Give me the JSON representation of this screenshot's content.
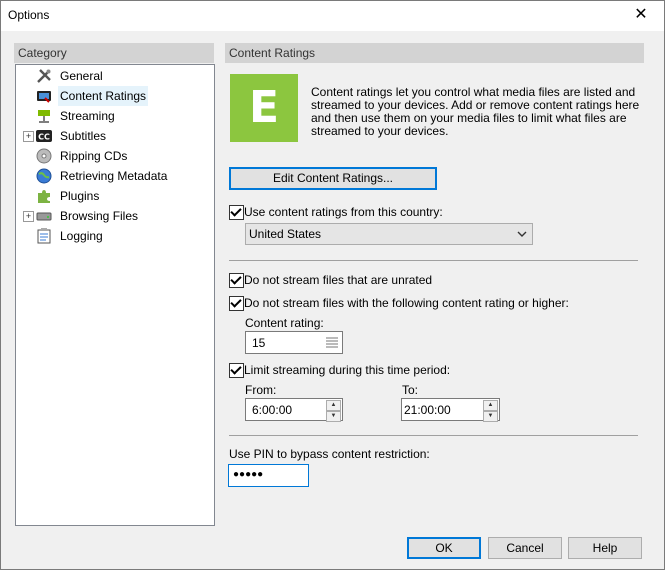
{
  "window": {
    "title": "Options"
  },
  "category": {
    "header": "Category",
    "items": [
      {
        "label": "General"
      },
      {
        "label": "Content Ratings"
      },
      {
        "label": "Streaming"
      },
      {
        "label": "Subtitles"
      },
      {
        "label": "Ripping CDs"
      },
      {
        "label": "Retrieving Metadata"
      },
      {
        "label": "Plugins"
      },
      {
        "label": "Browsing Files"
      },
      {
        "label": "Logging"
      }
    ]
  },
  "panel": {
    "header": "Content Ratings",
    "badge_letter": "E",
    "badge_color": "#8cc63f",
    "description": "Content ratings let you control what media files are listed and streamed to your devices.  Add or remove content ratings here and then use them on your media files to limit what files are streamed to your devices.",
    "edit_button": "Edit Content Ratings...",
    "use_country_label": "Use content ratings from this country:",
    "country": "United States",
    "unrated_label": "Do not stream files that are unrated",
    "rating_or_higher_label": "Do not stream files with the following content rating or higher:",
    "content_rating_label": "Content rating:",
    "content_rating_value": "15",
    "limit_time_label": "Limit streaming during this time period:",
    "from_label": "From:",
    "from_value": "6:00:00",
    "to_label": "To:",
    "to_value": "21:00:00",
    "pin_label": "Use PIN to bypass content restriction:",
    "pin_value": "●●●●●"
  },
  "buttons": {
    "ok": "OK",
    "cancel": "Cancel",
    "help": "Help"
  }
}
